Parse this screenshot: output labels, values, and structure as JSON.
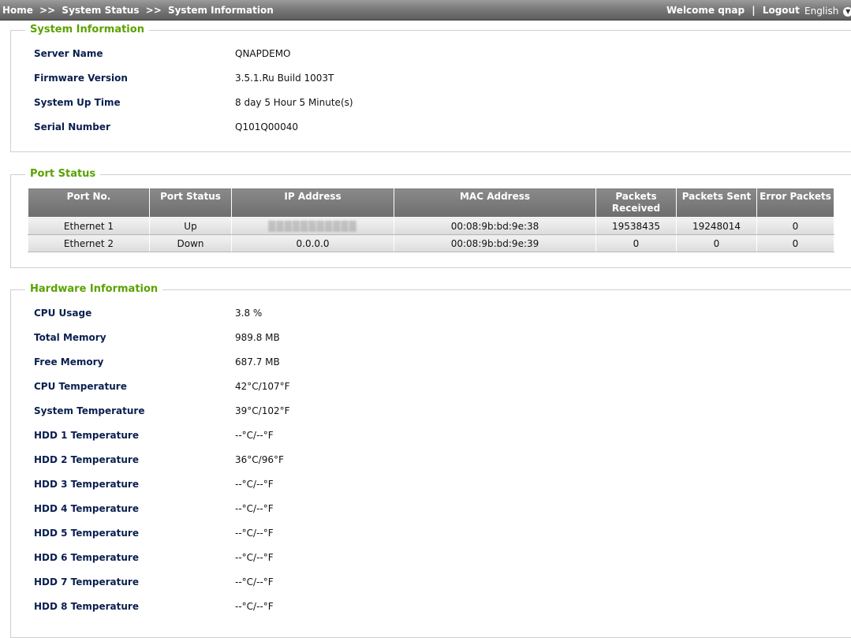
{
  "breadcrumb": {
    "home": "Home",
    "separator": ">>",
    "system_status": "System Status",
    "system_information": "System Information"
  },
  "header": {
    "welcome": "Welcome qnap",
    "divider": "|",
    "logout": "Logout",
    "language": "English"
  },
  "system_info": {
    "legend": "System Information",
    "rows": [
      {
        "label": "Server Name",
        "value": "QNAPDEMO"
      },
      {
        "label": "Firmware Version",
        "value": "3.5.1.Ru Build 1003T"
      },
      {
        "label": "System Up Time",
        "value": "8 day 5 Hour 5 Minute(s)"
      },
      {
        "label": "Serial Number",
        "value": "Q101Q00040"
      }
    ]
  },
  "port_status": {
    "legend": "Port Status",
    "headers": [
      "Port No.",
      "Port Status",
      "IP Address",
      "MAC Address",
      "Packets Received",
      "Packets Sent",
      "Error Packets"
    ],
    "rows": [
      [
        "Ethernet 1",
        "Up",
        "",
        "00:08:9b:bd:9e:38",
        "19538435",
        "19248014",
        "0"
      ],
      [
        "Ethernet 2",
        "Down",
        "0.0.0.0",
        "00:08:9b:bd:9e:39",
        "0",
        "0",
        "0"
      ]
    ]
  },
  "hardware_info": {
    "legend": "Hardware Information",
    "rows": [
      {
        "label": "CPU Usage",
        "value": "3.8 %"
      },
      {
        "label": "Total Memory",
        "value": "989.8 MB"
      },
      {
        "label": "Free Memory",
        "value": "687.7 MB"
      },
      {
        "label": "CPU Temperature",
        "value": "42°C/107°F"
      },
      {
        "label": "System Temperature",
        "value": "39°C/102°F"
      },
      {
        "label": "HDD 1 Temperature",
        "value": "--°C/--°F"
      },
      {
        "label": "HDD 2 Temperature",
        "value": "36°C/96°F"
      },
      {
        "label": "HDD 3 Temperature",
        "value": "--°C/--°F"
      },
      {
        "label": "HDD 4 Temperature",
        "value": "--°C/--°F"
      },
      {
        "label": "HDD 5 Temperature",
        "value": "--°C/--°F"
      },
      {
        "label": "HDD 6 Temperature",
        "value": "--°C/--°F"
      },
      {
        "label": "HDD 7 Temperature",
        "value": "--°C/--°F"
      },
      {
        "label": "HDD 8 Temperature",
        "value": "--°C/--°F"
      }
    ]
  },
  "colors": {
    "legend_green": "#5aa200",
    "label_navy": "#0a1f4f",
    "header_gray": "#6d6d6d"
  },
  "icons": {
    "language_dropdown": "chevron-down-icon"
  }
}
